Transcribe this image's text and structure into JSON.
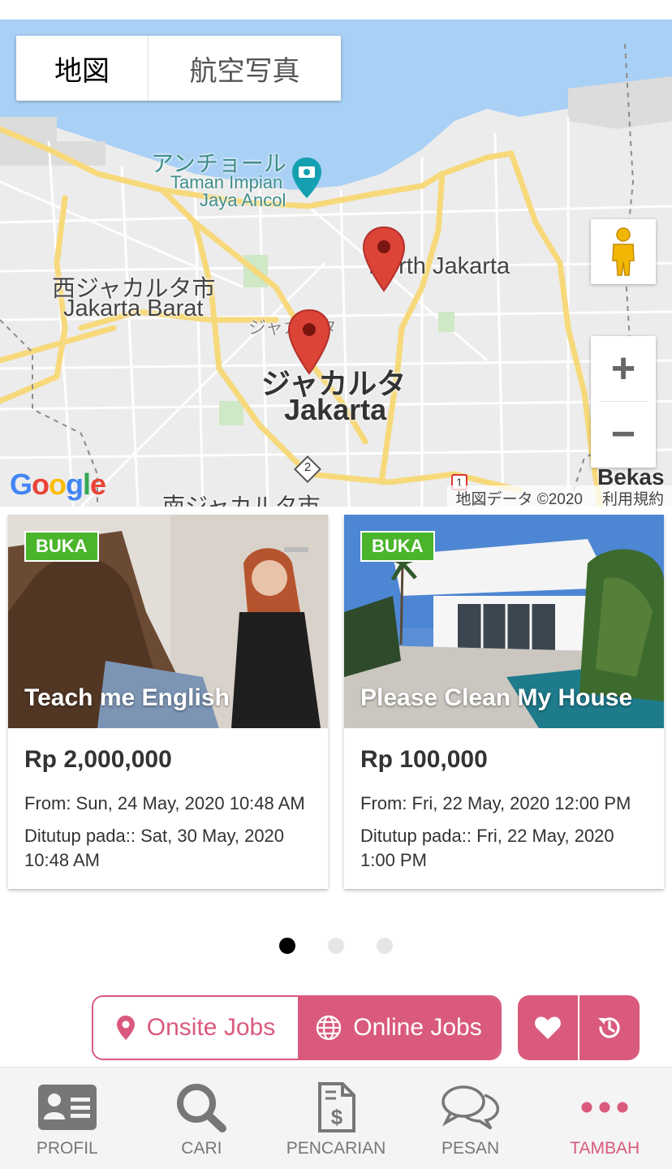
{
  "map": {
    "type_tabs": [
      "地図",
      "航空写真"
    ],
    "labels": {
      "ancol_jp": "アンチョール",
      "ancol_1": "Taman Impian",
      "ancol_2": "Jaya Ancol",
      "west_jp": "西ジャカルタ市",
      "west_en": "Jakarta Barat",
      "north_en": "North Jakarta",
      "jakarta_small": "ジャカルタ",
      "center_jp": "ジャカルタ",
      "center_en": "Jakarta",
      "south_jp": "南ジャカルタ市",
      "bekasi": "Bekas",
      "route_2": "2",
      "route_1": "1"
    },
    "google_logo": "Google",
    "attribution": "地図データ ©2020",
    "terms": "利用規約",
    "zoom_in": "+",
    "zoom_out": "−",
    "colors": {
      "water": "#a9d0f5",
      "land": "#ececec",
      "road": "#f7d97b",
      "marker": "#db4437"
    }
  },
  "cards": [
    {
      "badge": "BUKA",
      "title": "Teach me English",
      "price": "Rp 2,000,000",
      "from": "From: Sun, 24 May, 2020 10:48 AM",
      "closed": "Ditutup pada:: Sat, 30 May, 2020 10:48 AM"
    },
    {
      "badge": "BUKA",
      "title": "Please Clean My House",
      "price": "Rp 100,000",
      "from": "From: Fri, 22 May, 2020 12:00 PM",
      "closed": "Ditutup pada:: Fri, 22 May, 2020 1:00 PM"
    }
  ],
  "pagination": {
    "pages": 3,
    "current": 1
  },
  "job_toggle": {
    "onsite_label": "Onsite Jobs",
    "online_label": "Online Jobs",
    "selected": "Online Jobs"
  },
  "actions": [
    "heart-icon",
    "history-icon"
  ],
  "bottom_nav": [
    {
      "label": "PROFIL",
      "icon": "profile-card-icon"
    },
    {
      "label": "CARI",
      "icon": "search-icon"
    },
    {
      "label": "PENCARIAN",
      "icon": "invoice-icon"
    },
    {
      "label": "PESAN",
      "icon": "chat-icon"
    },
    {
      "label": "TAMBAH",
      "icon": "more-icon",
      "active": true
    }
  ],
  "accent_color": "#d95a7c",
  "badge_color": "#4ab52b"
}
